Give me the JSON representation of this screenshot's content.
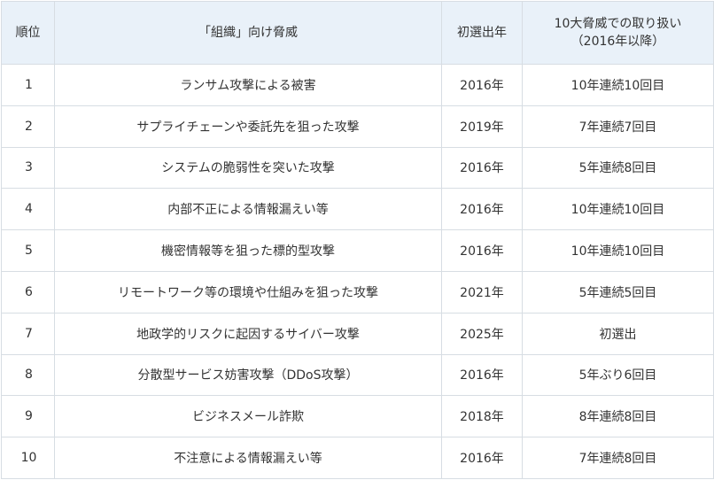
{
  "table": {
    "headers": {
      "rank": "順位",
      "threat": "「組織」向け脅威",
      "first_selected": "初選出年",
      "handling_line1": "10大脅威での取り扱い",
      "handling_line2": "（2016年以降）"
    },
    "rows": [
      {
        "rank": "1",
        "threat": "ランサム攻撃による被害",
        "first_selected": "2016年",
        "handling": "10年連続10回目"
      },
      {
        "rank": "2",
        "threat": "サプライチェーンや委託先を狙った攻撃",
        "first_selected": "2019年",
        "handling": "7年連続7回目"
      },
      {
        "rank": "3",
        "threat": "システムの脆弱性を突いた攻撃",
        "first_selected": "2016年",
        "handling": "5年連続8回目"
      },
      {
        "rank": "4",
        "threat": "内部不正による情報漏えい等",
        "first_selected": "2016年",
        "handling": "10年連続10回目"
      },
      {
        "rank": "5",
        "threat": "機密情報等を狙った標的型攻撃",
        "first_selected": "2016年",
        "handling": "10年連続10回目"
      },
      {
        "rank": "6",
        "threat": "リモートワーク等の環境や仕組みを狙った攻撃",
        "first_selected": "2021年",
        "handling": "5年連続5回目"
      },
      {
        "rank": "7",
        "threat": "地政学的リスクに起因するサイバー攻撃",
        "first_selected": "2025年",
        "handling": "初選出"
      },
      {
        "rank": "8",
        "threat": "分散型サービス妨害攻撃（DDoS攻撃）",
        "first_selected": "2016年",
        "handling": "5年ぶり6回目"
      },
      {
        "rank": "9",
        "threat": "ビジネスメール詐欺",
        "first_selected": "2018年",
        "handling": "8年連続8回目"
      },
      {
        "rank": "10",
        "threat": "不注意による情報漏えい等",
        "first_selected": "2016年",
        "handling": "7年連続8回目"
      }
    ]
  },
  "colors": {
    "header_background": "#e9f1f9",
    "border": "#d7dde3",
    "text": "#333333"
  }
}
